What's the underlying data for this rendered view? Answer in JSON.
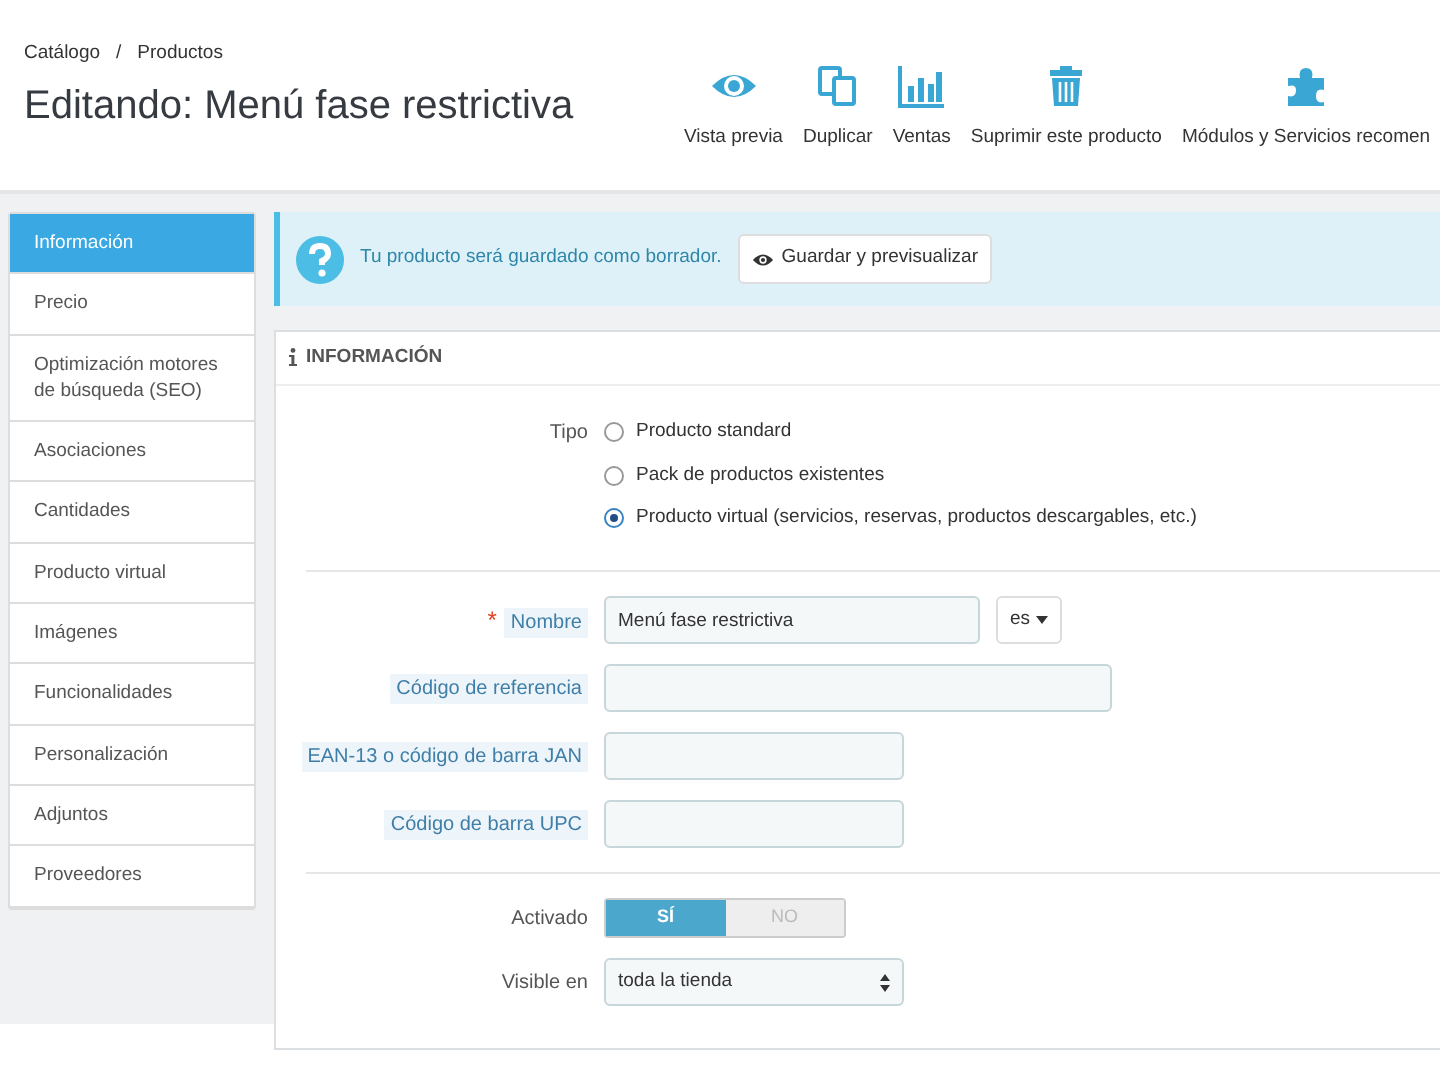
{
  "breadcrumb": [
    "Catálogo",
    "/",
    "Productos"
  ],
  "page_title": "Editando: Menú fase restrictiva",
  "toolbar": [
    {
      "kind": "eye",
      "label": "Vista previa"
    },
    {
      "kind": "copy",
      "label": "Duplicar"
    },
    {
      "kind": "chart",
      "label": "Ventas"
    },
    {
      "kind": "trash",
      "label": "Suprimir este producto"
    },
    {
      "kind": "puzzle",
      "label": "Módulos y Servicios recomen"
    }
  ],
  "sidebar": {
    "items": [
      {
        "label": "Información",
        "selected": true
      },
      {
        "label": "Precio",
        "selected": false
      },
      {
        "label": "Optimización motores de búsqueda (SEO)",
        "selected": false
      },
      {
        "label": "Asociaciones",
        "selected": false
      },
      {
        "label": "Cantidades",
        "selected": false
      },
      {
        "label": "Producto virtual",
        "selected": false
      },
      {
        "label": "Imágenes",
        "selected": false
      },
      {
        "label": "Funcionalidades",
        "selected": false
      },
      {
        "label": "Personalización",
        "selected": false
      },
      {
        "label": "Adjuntos",
        "selected": false
      },
      {
        "label": "Proveedores",
        "selected": false
      }
    ]
  },
  "alert": {
    "message": "Tu producto será guardado como borrador.",
    "button": "Guardar y previsualizar"
  },
  "panel": {
    "heading": "INFORMACIÓN",
    "type": {
      "label": "Tipo",
      "options": [
        {
          "label": "Producto standard",
          "selected": false
        },
        {
          "label": "Pack de productos existentes",
          "selected": false
        },
        {
          "label": "Producto virtual (servicios, reservas, productos descargables, etc.)",
          "selected": true
        }
      ]
    },
    "fields": [
      {
        "kind": "text",
        "label": "Nombre",
        "required_mark": "*",
        "value": "Menú fase restrictiva",
        "language": "es"
      },
      {
        "kind": "text",
        "label": "Código de referencia"
      },
      {
        "kind": "text",
        "label": "EAN-13 o código de barra JAN"
      },
      {
        "kind": "text",
        "label": "Código de barra UPC"
      }
    ],
    "settings": [
      {
        "kind": "switch",
        "label": "Activado",
        "options": [
          {
            "label": "SÍ",
            "selected": true
          },
          {
            "label": "NO",
            "selected": false
          }
        ]
      },
      {
        "kind": "select",
        "label": "Visible en",
        "value": "toda la tienda"
      }
    ]
  }
}
